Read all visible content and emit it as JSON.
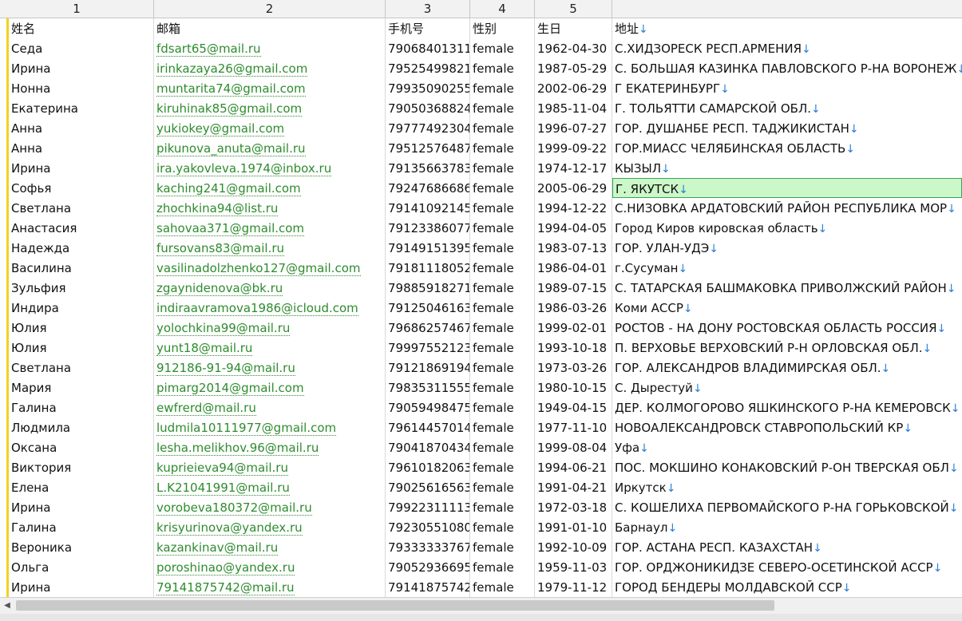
{
  "columns": [
    "1",
    "2",
    "3",
    "4",
    "5",
    ""
  ],
  "headers": {
    "name": "姓名",
    "email": "邮箱",
    "phone": "手机号",
    "gender": "性别",
    "dob": "生日",
    "address": "地址"
  },
  "rows": [
    {
      "name": "Седа",
      "email": "fdsart65@mail.ru",
      "phone": "79068401311",
      "gender": "female",
      "dob": "1962-04-30",
      "address": "С.ХИДЗОРЕСК РЕСП.АРМЕНИЯ"
    },
    {
      "name": "Ирина",
      "email": "irinkazaya26@gmail.com",
      "phone": "79525499821",
      "gender": "female",
      "dob": "1987-05-29",
      "address": "С. БОЛЬШАЯ КАЗИНКА ПАВЛОВСКОГО Р-НА ВОРОНЕЖ"
    },
    {
      "name": "Нонна",
      "email": "muntarita74@gmail.com",
      "phone": "79935090255",
      "gender": "female",
      "dob": "2002-06-29",
      "address": "Г ЕКАТЕРИНБУРГ"
    },
    {
      "name": "Екатерина",
      "email": "kiruhinak85@gmail.com",
      "phone": "79050368824",
      "gender": "female",
      "dob": "1985-11-04",
      "address": "Г. ТОЛЬЯТТИ САМАРСКОЙ ОБЛ."
    },
    {
      "name": "Анна",
      "email": "yukiokey@gmail.com",
      "phone": "79777492304",
      "gender": "female",
      "dob": "1996-07-27",
      "address": "ГОР. ДУШАНБЕ РЕСП. ТАДЖИКИСТАН"
    },
    {
      "name": "Анна",
      "email": "pikunova_anuta@mail.ru",
      "phone": "79512576487",
      "gender": "female",
      "dob": "1999-09-22",
      "address": "ГОР.МИАСС ЧЕЛЯБИНСКАЯ ОБЛАСТЬ"
    },
    {
      "name": "Ирина",
      "email": "ira.yakovleva.1974@inbox.ru",
      "phone": "79135663783",
      "gender": "female",
      "dob": "1974-12-17",
      "address": "КЫЗЫЛ"
    },
    {
      "name": "Софья",
      "email": "kaching241@gmail.com",
      "phone": "79247686686",
      "gender": "female",
      "dob": "2005-06-29",
      "address": "Г. ЯКУТСК",
      "selected": true
    },
    {
      "name": "Светлана",
      "email": "zhochkina94@list.ru",
      "phone": "79141092145",
      "gender": "female",
      "dob": "1994-12-22",
      "address": "С.НИЗОВКА АРДАТОВСКИЙ РАЙОН РЕСПУБЛИКА МОР"
    },
    {
      "name": "Анастасия",
      "email": "sahovaa371@gmail.com",
      "phone": "79123386077",
      "gender": "female",
      "dob": "1994-04-05",
      "address": "Город Киров кировская область"
    },
    {
      "name": "Надежда",
      "email": "fursovans83@mail.ru",
      "phone": "79149151395",
      "gender": "female",
      "dob": "1983-07-13",
      "address": "ГОР. УЛАН-УДЭ"
    },
    {
      "name": "Василина",
      "email": "vasilinadolzhenko127@gmail.com",
      "phone": "79181118052",
      "gender": "female",
      "dob": "1986-04-01",
      "address": "г.Сусуман"
    },
    {
      "name": "Зульфия",
      "email": "zgaynidenova@bk.ru",
      "phone": "79885918271",
      "gender": "female",
      "dob": "1989-07-15",
      "address": "С. ТАТАРСКАЯ БАШМАКОВКА ПРИВОЛЖСКИЙ РАЙОН"
    },
    {
      "name": "Индира",
      "email": "indiraavramova1986@icloud.com",
      "phone": "79125046163",
      "gender": "female",
      "dob": "1986-03-26",
      "address": "Коми АССР"
    },
    {
      "name": "Юлия",
      "email": "yolochkina99@mail.ru",
      "phone": "79686257467",
      "gender": "female",
      "dob": "1999-02-01",
      "address": "РОСТОВ - НА ДОНУ РОСТОВСКАЯ ОБЛАСТЬ РОССИЯ"
    },
    {
      "name": "Юлия",
      "email": "yunt18@mail.ru",
      "phone": "79997552123",
      "gender": "female",
      "dob": "1993-10-18",
      "address": "П. ВЕРХОВЬЕ ВЕРХОВСКИЙ Р-Н ОРЛОВСКАЯ ОБЛ."
    },
    {
      "name": "Светлана",
      "email": "912186-91-94@mail.ru",
      "phone": "79121869194",
      "gender": "female",
      "dob": "1973-03-26",
      "address": "ГОР. АЛЕКСАНДРОВ ВЛАДИМИРСКАЯ ОБЛ."
    },
    {
      "name": "Мария",
      "email": "pimarg2014@gmail.com",
      "phone": "79835311555",
      "gender": "female",
      "dob": "1980-10-15",
      "address": "С. Дырестуй"
    },
    {
      "name": "Галина",
      "email": "ewfrerd@mail.ru",
      "phone": "79059498475",
      "gender": "female",
      "dob": "1949-04-15",
      "address": "ДЕР. КОЛМОГОРОВО ЯШКИНСКОГО Р-НА КЕМЕРОВСК"
    },
    {
      "name": "Людмила",
      "email": "ludmila10111977@gmail.com",
      "phone": "79614457014",
      "gender": "female",
      "dob": "1977-11-10",
      "address": "НОВОАЛЕКСАНДРОВСК СТАВРОПОЛЬСКИЙ КР"
    },
    {
      "name": "Оксана",
      "email": "lesha.melikhov.96@mail.ru",
      "phone": "79041870434",
      "gender": "female",
      "dob": "1999-08-04",
      "address": "Уфа"
    },
    {
      "name": "Виктория",
      "email": "kuprieieva94@mail.ru",
      "phone": "79610182063",
      "gender": "female",
      "dob": "1994-06-21",
      "address": "ПОС. МОКШИНО КОНАКОВСКИЙ Р-ОН ТВЕРСКАЯ ОБЛ"
    },
    {
      "name": "Елена",
      "email": "L.K21041991@mail.ru",
      "phone": "79025616563",
      "gender": "female",
      "dob": "1991-04-21",
      "address": "Иркутск"
    },
    {
      "name": "Ирина",
      "email": "vorobeva180372@mail.ru",
      "phone": "79922311113",
      "gender": "female",
      "dob": "1972-03-18",
      "address": "С. КОШЕЛИХА ПЕРВОМАЙСКОГО Р-НА ГОРЬКОВСКОЙ"
    },
    {
      "name": "Галина",
      "email": "krisyurinova@yandex.ru",
      "phone": "79230551080",
      "gender": "female",
      "dob": "1991-01-10",
      "address": "Барнаул"
    },
    {
      "name": "Вероника",
      "email": "kazankinav@mail.ru",
      "phone": "79333333767",
      "gender": "female",
      "dob": "1992-10-09",
      "address": "ГОР. АСТАНА РЕСП. КАЗАХСТАН"
    },
    {
      "name": "Ольга",
      "email": "poroshinao@yandex.ru",
      "phone": "79052936695",
      "gender": "female",
      "dob": "1959-11-03",
      "address": "ГОР. ОРДЖОНИКИДЗЕ СЕВЕРО-ОСЕТИНСКОЙ АССР"
    },
    {
      "name": "Ирина",
      "email": "79141875742@mail.ru",
      "phone": "79141875742",
      "gender": "female",
      "dob": "1979-11-12",
      "address": "ГОРОД БЕНДЕРЫ МОЛДАВСКОЙ ССР"
    }
  ],
  "icons": {
    "line_break": "down-arrow-icon",
    "scroll_left": "triangle-left-icon"
  },
  "colors": {
    "email_link": "#2e8b2e",
    "selection_fill": "#ccf7c8",
    "row_marker": "#f2d21e",
    "arrow": "#2a7fd4"
  }
}
